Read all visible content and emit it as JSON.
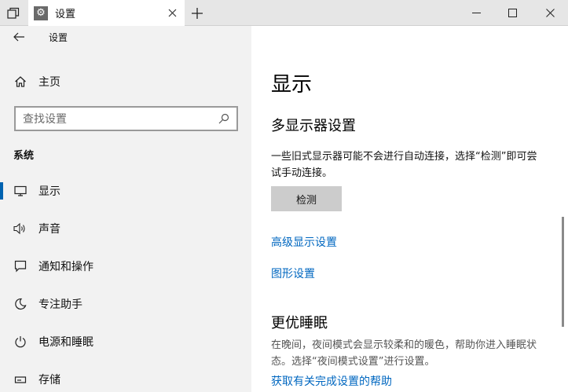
{
  "titlebar": {
    "tab_title": "设置"
  },
  "sidebar": {
    "title": "设置",
    "home_label": "主页",
    "search_placeholder": "查找设置",
    "section_label": "系统",
    "items": [
      {
        "label": "显示",
        "icon": "monitor-icon",
        "active": true
      },
      {
        "label": "声音",
        "icon": "speaker-icon"
      },
      {
        "label": "通知和操作",
        "icon": "notification-icon"
      },
      {
        "label": "专注助手",
        "icon": "moon-icon"
      },
      {
        "label": "电源和睡眠",
        "icon": "power-icon"
      },
      {
        "label": "存储",
        "icon": "storage-icon"
      }
    ]
  },
  "main": {
    "page_title": "显示",
    "multi_display_heading": "多显示器设置",
    "multi_display_desc": "一些旧式显示器可能不会进行自动连接，选择“检测”即可尝试手动连接。",
    "detect_button": "检测",
    "advanced_link": "高级显示设置",
    "graphics_link": "图形设置",
    "sleep_heading": "更优睡眠",
    "sleep_desc": "在晚间，夜间模式会显示较柔和的暖色，帮助你进入睡眠状态。选择“夜间模式设置”进行设置。",
    "help_link": "获取有关完成设置的帮助"
  },
  "colors": {
    "accent": "#0063b1",
    "link": "#0067c0",
    "sidebar_bg": "#f2f2f2",
    "titlebar_bg": "#e6e6e6",
    "button_bg": "#cccccc"
  }
}
